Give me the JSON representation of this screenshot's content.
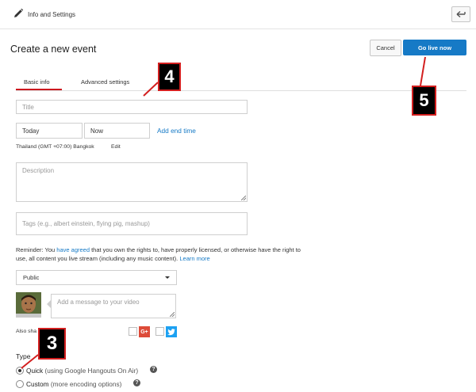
{
  "topbar": {
    "title": "Info and Settings",
    "back_icon": "back-arrow-icon",
    "edit_icon": "pencil-icon"
  },
  "header": {
    "title": "Create a new event",
    "cancel_label": "Cancel",
    "golive_label": "Go live now",
    "golive_color": "#167ac6"
  },
  "tabs": [
    {
      "label": "Basic info",
      "active": true
    },
    {
      "label": "Advanced settings",
      "active": false
    }
  ],
  "form": {
    "title_placeholder": "Title",
    "date_value": "Today",
    "time_value": "Now",
    "add_end_time": "Add end time",
    "timezone": "Thailand (GMT +07:00) Bangkok",
    "edit_label": "Edit",
    "description_placeholder": "Description",
    "tags_placeholder": "Tags (e.g., albert einstein, flying pig, mashup)"
  },
  "reminder": {
    "prefix": "Reminder: You ",
    "link1": "have agreed",
    "middle": " that you own the rights to, have properly licensed, or otherwise have the right to use, all content you live stream (including any music content). ",
    "link2": "Learn more"
  },
  "privacy": {
    "selected": "Public"
  },
  "share": {
    "message_placeholder": "Add a message to your video",
    "also_share_label": "Also sha",
    "gplus_label": "G+",
    "gplus_color": "#dd4b39",
    "twitter_color": "#1da1f2"
  },
  "type": {
    "heading": "Type",
    "options": [
      {
        "label": "Quick",
        "detail": " (using Google Hangouts On Air)",
        "selected": true
      },
      {
        "label": "Custom",
        "detail": " (more encoding options)",
        "selected": false
      }
    ],
    "help_glyph": "?"
  },
  "callouts": {
    "c3": "3",
    "c4": "4",
    "c5": "5",
    "color": "#d31f1f"
  }
}
